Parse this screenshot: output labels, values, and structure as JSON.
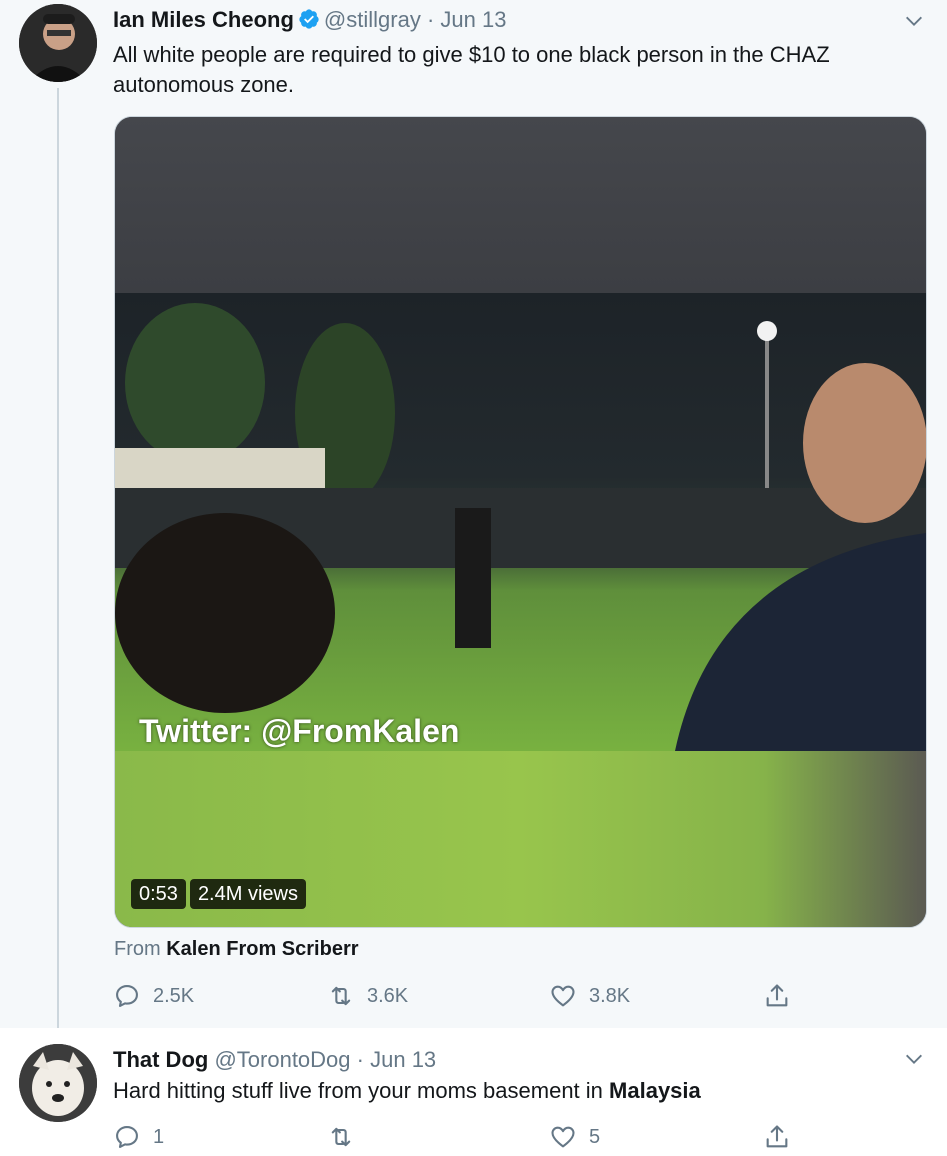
{
  "tweets": [
    {
      "author": "Ian Miles Cheong",
      "verified": true,
      "handle": "@stillgray",
      "separator": "·",
      "date": "Jun 13",
      "text": "All white people are required to give $10 to one black person in the CHAZ autonomous zone.",
      "media": {
        "watermark": "Twitter: @FromKalen",
        "duration": "0:53",
        "views": "2.4M views"
      },
      "source_prefix": "From",
      "source_name": "Kalen From Scriberr",
      "replies": "2.5K",
      "retweets": "3.6K",
      "likes": "3.8K"
    },
    {
      "author": "That Dog",
      "verified": false,
      "handle": "@TorontoDog",
      "separator": "·",
      "date": "Jun 13",
      "text_main": "Hard hitting stuff live from your moms basement in",
      "text_bold": "Malaysia",
      "replies": "1",
      "retweets": "",
      "likes": "5"
    }
  ],
  "colors": {
    "verified": "#1da1f2",
    "muted": "#657786",
    "thread_line": "#ccd6dd"
  }
}
